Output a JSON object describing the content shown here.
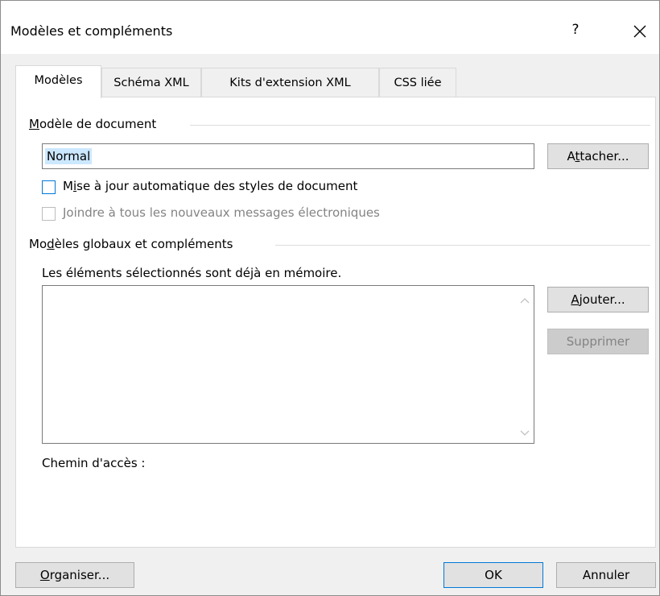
{
  "window": {
    "title": "Modèles et compléments",
    "help_label": "?"
  },
  "tabs": [
    {
      "label": "Modèles",
      "active": true
    },
    {
      "label": "Schéma XML",
      "active": false
    },
    {
      "label": "Kits d'extension XML",
      "active": false
    },
    {
      "label": "CSS liée",
      "active": false
    }
  ],
  "document_template": {
    "group_label_first": "M",
    "group_label_rest": "odèle de document",
    "value": "Normal",
    "attach_button_pre": "A",
    "attach_button_key": "t",
    "attach_button_post": "tacher...",
    "auto_update_pre": "M",
    "auto_update_key": "i",
    "auto_update_post": "se à jour automatique des styles de document",
    "auto_update_checked": false,
    "attach_to_email": "Joindre à tous les nouveaux messages électroniques",
    "attach_to_email_checked": false
  },
  "global_templates": {
    "group_label_pre": "Mo",
    "group_label_key": "d",
    "group_label_post": "èles globaux et compléments",
    "hint": "Les éléments sélectionnés sont déjà en mémoire.",
    "items": [],
    "add_button_key": "A",
    "add_button_post": "jouter...",
    "remove_button": "Supprimer",
    "path_label": "Chemin d'accès :"
  },
  "footer": {
    "organize_key": "O",
    "organize_post": "rganiser...",
    "ok": "OK",
    "cancel": "Annuler"
  },
  "colors": {
    "accent": "#0078d7",
    "selection": "#cce8ff",
    "dialog_bg": "#f0f0f0"
  }
}
